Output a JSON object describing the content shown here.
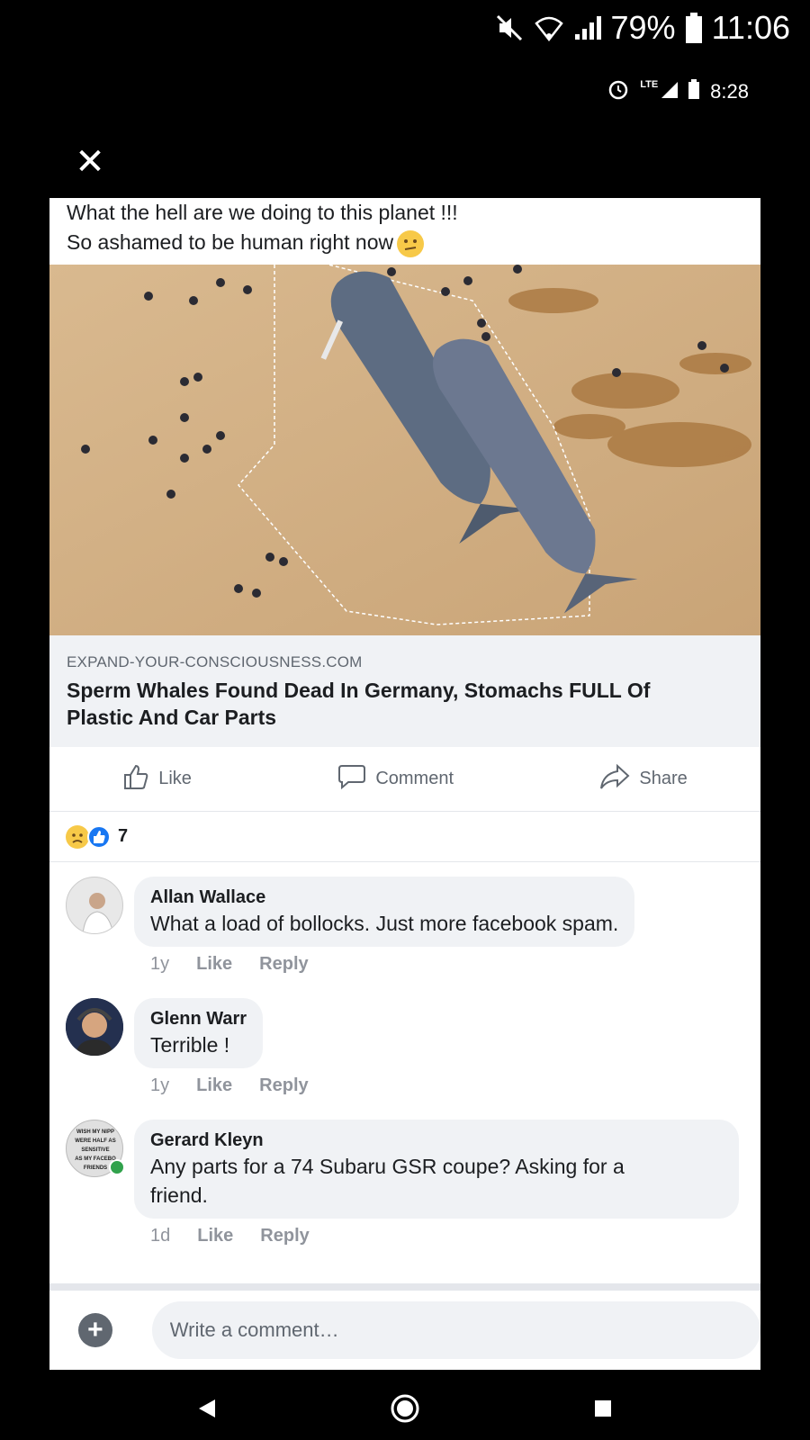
{
  "status_outer": {
    "battery": "79%",
    "time": "11:06"
  },
  "status_inner": {
    "network": "LTE",
    "time": "8:28"
  },
  "close": {
    "glyph": "✕"
  },
  "post": {
    "text_line1": "What the hell are we doing to this planet !!!",
    "text_line2": "So ashamed to be human right now"
  },
  "link": {
    "domain": "EXPAND-YOUR-CONSCIOUSNESS.COM",
    "title_line1": "Sperm Whales Found Dead In Germany, Stomachs FULL Of",
    "title_line2": "Plastic And Car Parts"
  },
  "actions": {
    "like": "Like",
    "comment": "Comment",
    "share": "Share"
  },
  "reactions": {
    "count": "7"
  },
  "comments": [
    {
      "name": "Allan Wallace",
      "text": "What a load of bollocks. Just more facebook spam.",
      "time": "1y",
      "like": "Like",
      "reply": "Reply"
    },
    {
      "name": "Glenn Warr",
      "text": "Terrible !",
      "time": "1y",
      "like": "Like",
      "reply": "Reply"
    },
    {
      "name": "Gerard Kleyn",
      "text_line1": "Any parts for a 74 Subaru GSR coupe? Asking for a",
      "text_line2": "friend.",
      "time": "1d",
      "like": "Like",
      "reply": "Reply",
      "avatar_text": "WISH MY NIPPLES WERE HALF AS SENSITIVE AS MY FACEBOOK FRIENDS"
    }
  ],
  "composer": {
    "placeholder": "Write a comment…"
  },
  "colors": {
    "accent": "#1877f2",
    "online": "#31a24c"
  }
}
